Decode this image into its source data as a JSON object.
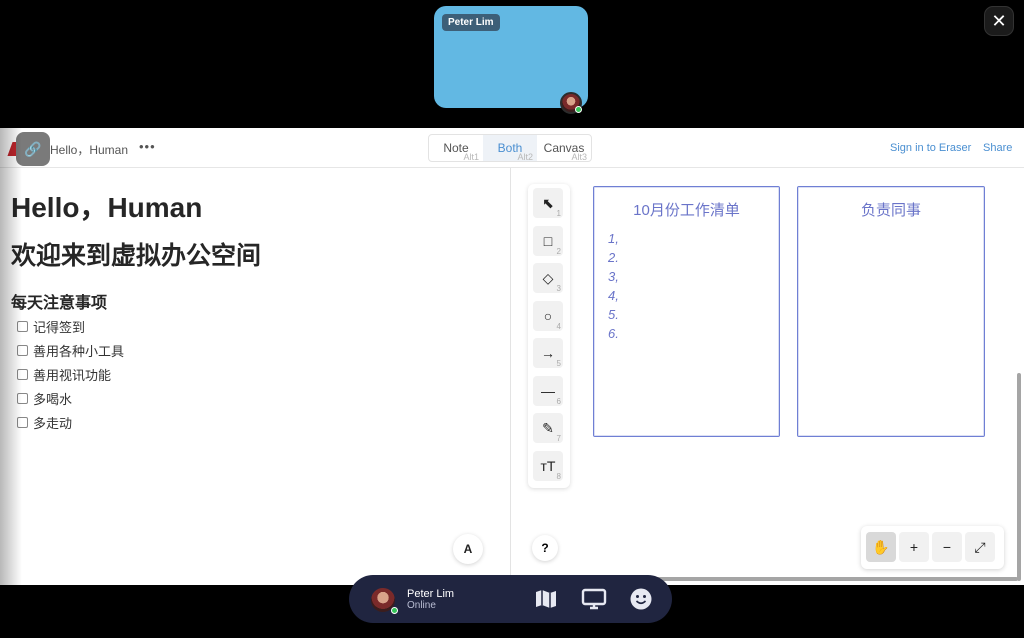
{
  "video": {
    "name": "Peter Lim"
  },
  "close_label": "✕",
  "app": {
    "doc_title": "Hello，Human",
    "more": "•••",
    "modes": [
      {
        "label": "Note",
        "shortcut": "Alt1"
      },
      {
        "label": "Both",
        "shortcut": "Alt2"
      },
      {
        "label": "Canvas",
        "shortcut": "Alt3"
      }
    ],
    "sign_in": "Sign in to Eraser",
    "share": "Share"
  },
  "note": {
    "heading1": "Hello，Human",
    "heading2": "欢迎来到虚拟办公空间",
    "heading3": "每天注意事项",
    "checklist": [
      "记得签到",
      "善用各种小工具",
      "善用视讯功能",
      "多喝水",
      "多走动"
    ],
    "font_button": "A"
  },
  "canvas": {
    "tools": [
      {
        "name": "select-tool",
        "glyph": "⬉",
        "key": "1"
      },
      {
        "name": "rectangle-tool",
        "glyph": "□",
        "key": "2"
      },
      {
        "name": "diamond-tool",
        "glyph": "◇",
        "key": "3"
      },
      {
        "name": "ellipse-tool",
        "glyph": "○",
        "key": "4"
      },
      {
        "name": "arrow-tool",
        "glyph": "→",
        "key": "5"
      },
      {
        "name": "line-tool",
        "glyph": "—",
        "key": "6"
      },
      {
        "name": "pencil-tool",
        "glyph": "✎",
        "key": "7"
      },
      {
        "name": "text-tool",
        "glyph": "тT",
        "key": "8"
      }
    ],
    "boards": [
      {
        "title": "10月份工作清单",
        "lines": [
          "1,",
          "2.",
          "3,",
          "4,",
          "5.",
          "6."
        ]
      },
      {
        "title": "负责同事",
        "lines": []
      }
    ],
    "help": "?",
    "zoom_buttons": [
      "✋",
      "+",
      "−",
      "⤢"
    ]
  },
  "bottom_bar": {
    "name": "Peter Lim",
    "status": "Online"
  },
  "colors": {
    "accent": "#4a8fd1",
    "board_stroke": "#6f7fd4",
    "bottom_bar": "#202540",
    "video_tile": "#62b8e3"
  }
}
